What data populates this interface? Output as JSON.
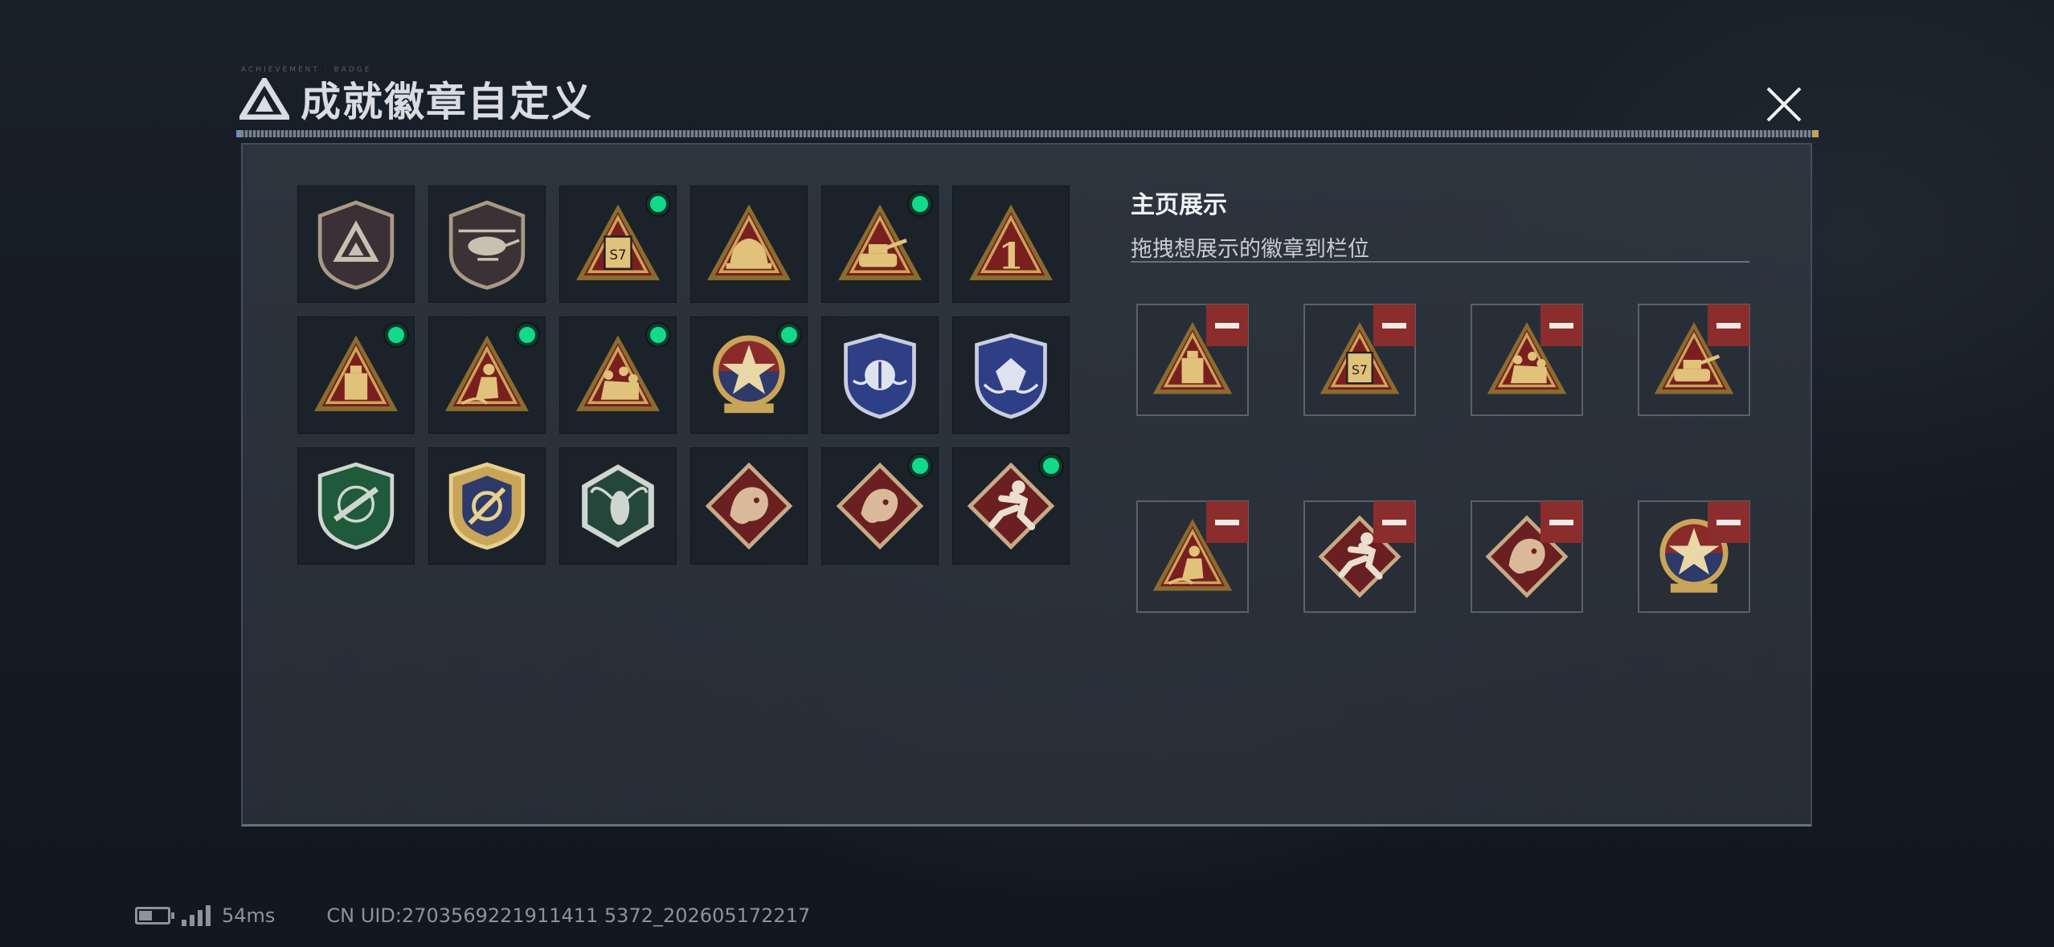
{
  "title": {
    "text": "成就徽章自定义",
    "subtext": "ACHIEVEMENT · BADGE",
    "logo_icon": "delta-logo-icon",
    "close_icon": "close-icon"
  },
  "colors": {
    "accent_green": "#13d98a",
    "remove_red": "#8b2d2d",
    "gold": "#c9a55a",
    "panel": "#2e3640"
  },
  "display": {
    "title": "主页展示",
    "subtitle": "拖拽想展示的徽章到栏位"
  },
  "badges": [
    {
      "icon": "delta-shield-badge-icon",
      "dot": false
    },
    {
      "icon": "helicopter-shield-badge-icon",
      "dot": false
    },
    {
      "icon": "s7-crate-triangle-badge-icon",
      "dot": true
    },
    {
      "icon": "hardhat-triangle-badge-icon",
      "dot": false
    },
    {
      "icon": "tank-triangle-badge-icon",
      "dot": true
    },
    {
      "icon": "number-one-triangle-badge-icon",
      "dot": false
    },
    {
      "icon": "usb-triangle-badge-icon",
      "dot": true
    },
    {
      "icon": "kneeling-soldier-triangle-badge-icon",
      "dot": true
    },
    {
      "icon": "squad-triangle-badge-icon",
      "dot": true
    },
    {
      "icon": "star-medal-badge-icon",
      "dot": true
    },
    {
      "icon": "blue-shield-winged-badge-icon",
      "dot": false
    },
    {
      "icon": "blue-shield-gem-badge-icon",
      "dot": false
    },
    {
      "icon": "green-rifle-shield-badge-icon",
      "dot": false
    },
    {
      "icon": "gold-crosshair-shield-badge-icon",
      "dot": false
    },
    {
      "icon": "wasp-hexagon-badge-icon",
      "dot": false
    },
    {
      "icon": "dragon-diamond-badge-icon",
      "dot": false
    },
    {
      "icon": "dragon-diamond-badge-2-icon",
      "dot": true
    },
    {
      "icon": "runner-diamond-badge-icon",
      "dot": true
    }
  ],
  "slots": [
    {
      "icon": "usb-triangle-badge-icon",
      "remove_icon": "minus-icon"
    },
    {
      "icon": "s7-crate-triangle-badge-icon",
      "remove_icon": "minus-icon"
    },
    {
      "icon": "squad-triangle-badge-icon",
      "remove_icon": "minus-icon"
    },
    {
      "icon": "tank-triangle-badge-icon",
      "remove_icon": "minus-icon"
    },
    {
      "icon": "kneeling-soldier-triangle-badge-icon",
      "remove_icon": "minus-icon"
    },
    {
      "icon": "runner-diamond-badge-icon",
      "remove_icon": "minus-icon"
    },
    {
      "icon": "dragon-diamond-badge-icon",
      "remove_icon": "minus-icon"
    },
    {
      "icon": "star-medal-badge-icon",
      "remove_icon": "minus-icon"
    }
  ],
  "status": {
    "ping": "54ms",
    "uid": "CN UID:2703569221911411 5372_202605172217"
  }
}
